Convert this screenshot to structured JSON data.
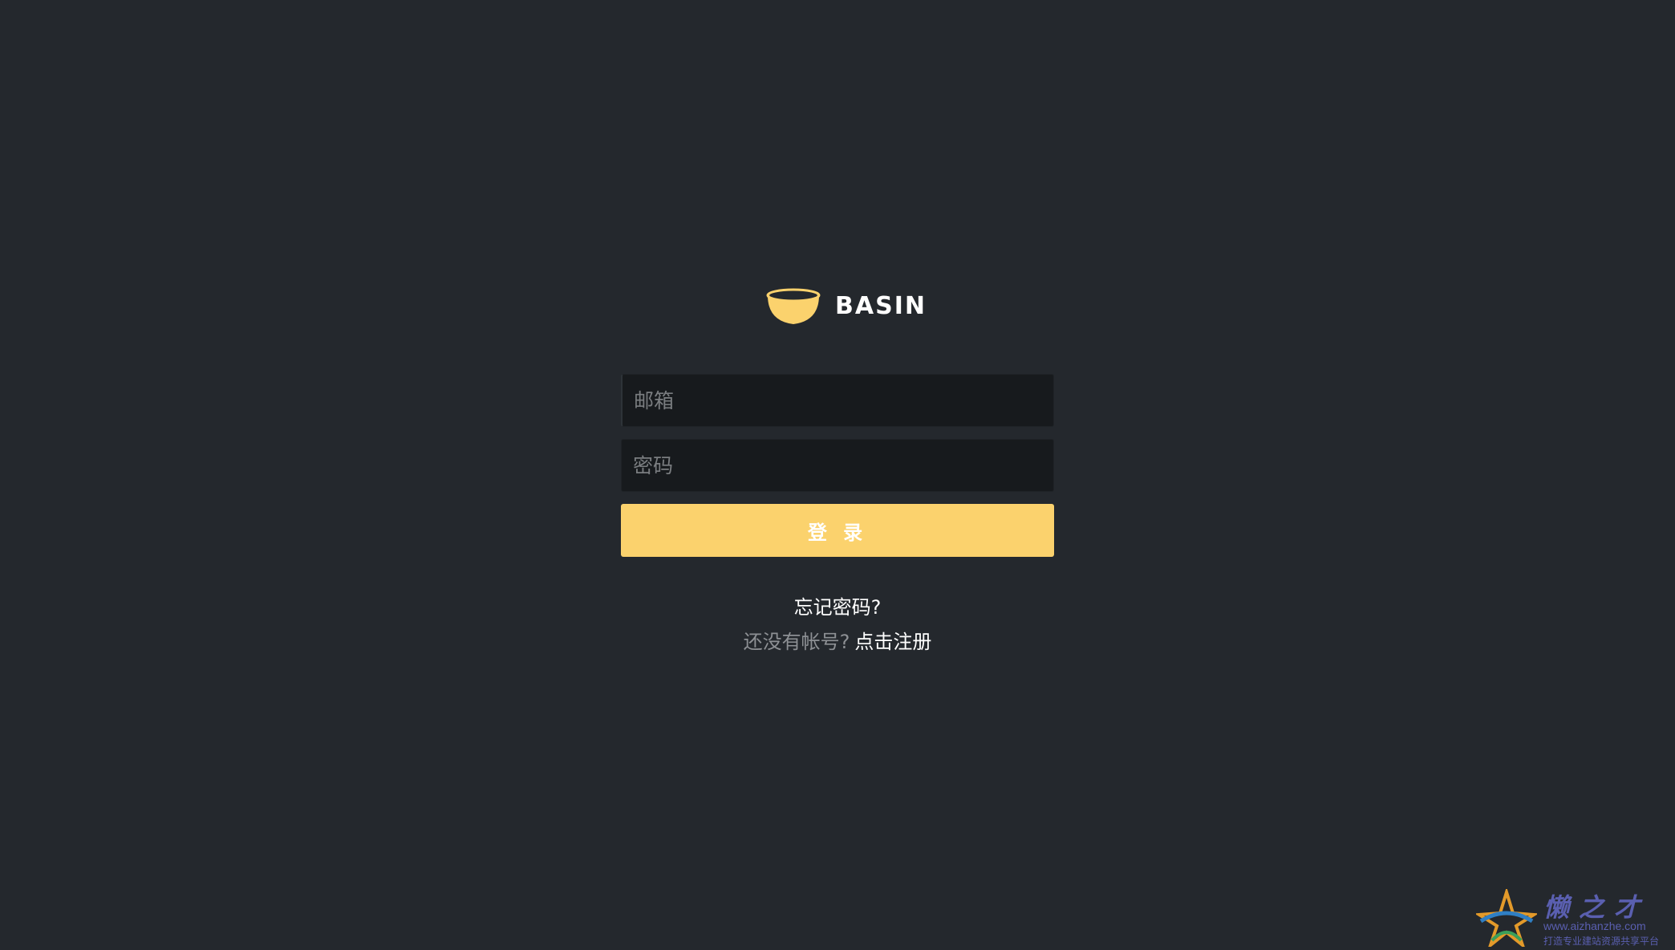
{
  "brand": {
    "name": "BASIN",
    "accent_color": "#fbd26d",
    "background_color": "#24282d",
    "icon": "bowl-logo-icon"
  },
  "login_form": {
    "email_placeholder": "邮箱",
    "password_placeholder": "密码",
    "submit_label": "登 录"
  },
  "links": {
    "forgot_password": "忘记密码?",
    "no_account_prompt": "还没有帐号?",
    "register": "点击注册"
  },
  "watermark": {
    "title": "懒之才",
    "url": "www.aizhanzhe.com",
    "slogan": "打造专业建站资源共享平台",
    "icon": "star-swirl-logo-icon"
  }
}
